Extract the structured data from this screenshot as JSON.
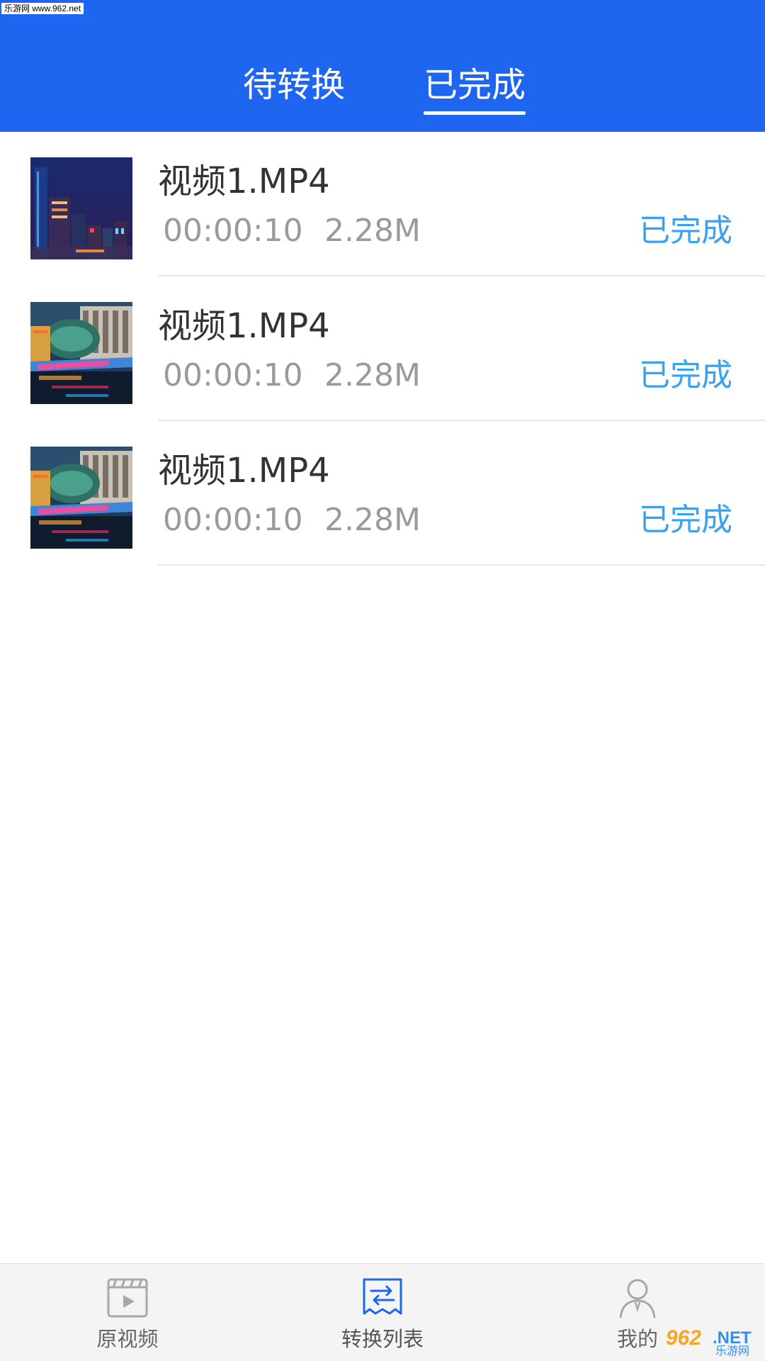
{
  "watermark_top": "乐游网 www.962.net",
  "header": {
    "tabs": [
      {
        "label": "待转换",
        "active": false
      },
      {
        "label": "已完成",
        "active": true
      }
    ],
    "background_color": "#1e66f0"
  },
  "list": {
    "items": [
      {
        "title": "视频1.MP4",
        "duration": "00:00:10",
        "size": "2.28M",
        "status": "已完成",
        "thumbnail": "city-skyline-night"
      },
      {
        "title": "视频1.MP4",
        "duration": "00:00:10",
        "size": "2.28M",
        "status": "已完成",
        "thumbnail": "riverside-building-night"
      },
      {
        "title": "视频1.MP4",
        "duration": "00:00:10",
        "size": "2.28M",
        "status": "已完成",
        "thumbnail": "riverside-building-night"
      }
    ],
    "status_color": "#3aa0f0"
  },
  "bottom_nav": {
    "items": [
      {
        "label": "原视频",
        "icon": "video-clapper-icon",
        "active": false
      },
      {
        "label": "转换列表",
        "icon": "convert-list-icon",
        "active": true
      },
      {
        "label": "我的",
        "icon": "user-icon",
        "active": false
      }
    ]
  },
  "watermark_bottom": {
    "number": "962",
    "suffix": ".NET",
    "cn": "乐游网"
  }
}
